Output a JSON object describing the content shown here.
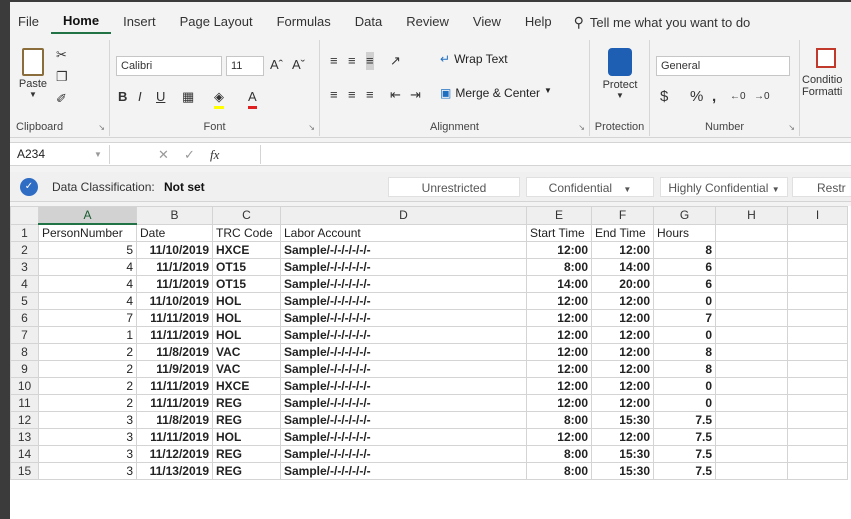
{
  "menu": [
    "File",
    "Home",
    "Insert",
    "Page Layout",
    "Formulas",
    "Data",
    "Review",
    "View",
    "Help"
  ],
  "tell_me": "Tell me what you want to do",
  "ribbon": {
    "clipboard": {
      "label": "Clipboard",
      "paste": "Paste"
    },
    "font": {
      "label": "Font",
      "name": "Calibri",
      "size": "11"
    },
    "alignment": {
      "label": "Alignment",
      "wrap_text": "Wrap Text",
      "merge_center": "Merge & Center"
    },
    "protection": {
      "label": "Protection",
      "protect": "Protect"
    },
    "number": {
      "label": "Number",
      "format": "General"
    },
    "styles": {
      "conditional": "Conditio",
      "formatting": "Formatti"
    }
  },
  "formula_bar": {
    "name_box": "A234",
    "fx": "fx",
    "value": ""
  },
  "classification": {
    "label": "Data Classification:",
    "status": "Not set",
    "options": [
      "Unrestricted",
      "Confidential",
      "Highly Confidential",
      "Restr"
    ]
  },
  "sheet": {
    "columns": [
      "A",
      "B",
      "C",
      "D",
      "E",
      "F",
      "G",
      "H",
      "I"
    ],
    "selected_column": "A",
    "header_row": [
      "PersonNumber",
      "Date",
      "TRC Code",
      "Labor Account",
      "Start Time",
      "End Time",
      "Hours",
      "",
      ""
    ],
    "rows": [
      [
        "5",
        "11/10/2019",
        "HXCE",
        "Sample/-/-/-/-/-/-",
        "12:00",
        "12:00",
        "8"
      ],
      [
        "4",
        "11/1/2019",
        "OT15",
        "Sample/-/-/-/-/-/-",
        "8:00",
        "14:00",
        "6"
      ],
      [
        "4",
        "11/1/2019",
        "OT15",
        "Sample/-/-/-/-/-/-",
        "14:00",
        "20:00",
        "6"
      ],
      [
        "4",
        "11/10/2019",
        "HOL",
        "Sample/-/-/-/-/-/-",
        "12:00",
        "12:00",
        "0"
      ],
      [
        "7",
        "11/11/2019",
        "HOL",
        "Sample/-/-/-/-/-/-",
        "12:00",
        "12:00",
        "7"
      ],
      [
        "1",
        "11/11/2019",
        "HOL",
        "Sample/-/-/-/-/-/-",
        "12:00",
        "12:00",
        "0"
      ],
      [
        "2",
        "11/8/2019",
        "VAC",
        "Sample/-/-/-/-/-/-",
        "12:00",
        "12:00",
        "8"
      ],
      [
        "2",
        "11/9/2019",
        "VAC",
        "Sample/-/-/-/-/-/-",
        "12:00",
        "12:00",
        "8"
      ],
      [
        "2",
        "11/11/2019",
        "HXCE",
        "Sample/-/-/-/-/-/-",
        "12:00",
        "12:00",
        "0"
      ],
      [
        "2",
        "11/11/2019",
        "REG",
        "Sample/-/-/-/-/-/-",
        "12:00",
        "12:00",
        "0"
      ],
      [
        "3",
        "11/8/2019",
        "REG",
        "Sample/-/-/-/-/-/-",
        "8:00",
        "15:30",
        "7.5"
      ],
      [
        "3",
        "11/11/2019",
        "HOL",
        "Sample/-/-/-/-/-/-",
        "12:00",
        "12:00",
        "7.5"
      ],
      [
        "3",
        "11/12/2019",
        "REG",
        "Sample/-/-/-/-/-/-",
        "8:00",
        "15:30",
        "7.5"
      ],
      [
        "3",
        "11/13/2019",
        "REG",
        "Sample/-/-/-/-/-/-",
        "8:00",
        "15:30",
        "7.5"
      ]
    ]
  }
}
